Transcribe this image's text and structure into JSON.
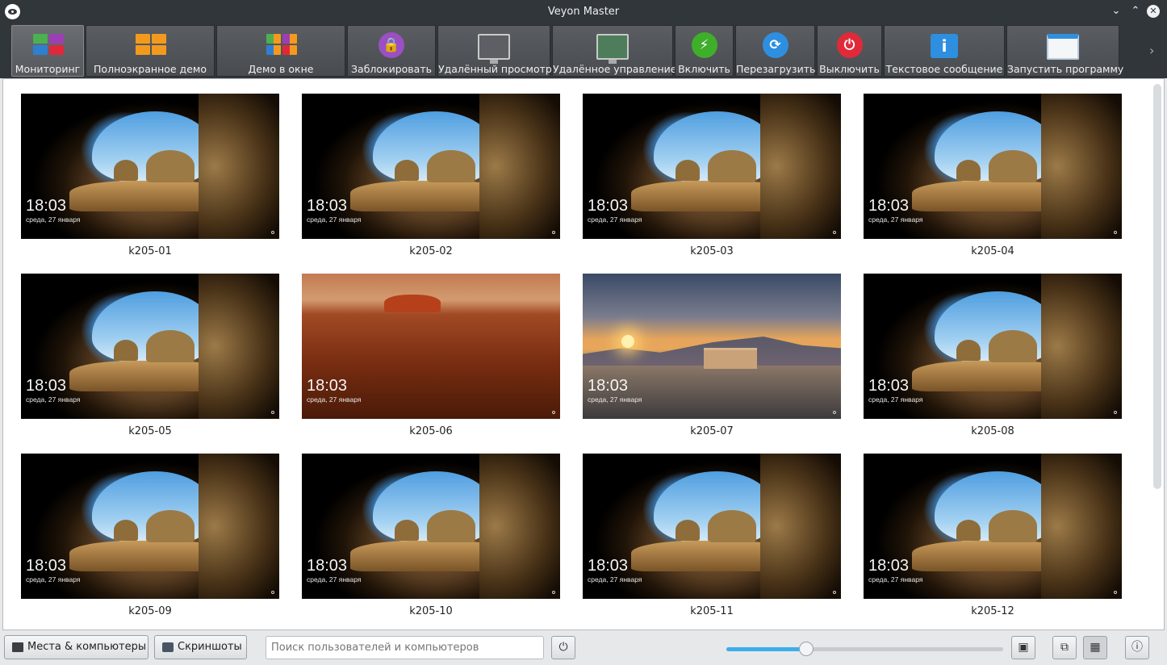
{
  "window": {
    "title": "Veyon Master"
  },
  "toolbar": {
    "buttons": [
      {
        "label": "Мониторинг",
        "icon": "monitoring-grid-icon",
        "active": true
      },
      {
        "label": "Полноэкранное демо",
        "icon": "fullscreen-demo-icon"
      },
      {
        "label": "Демо в окне",
        "icon": "window-demo-icon"
      },
      {
        "label": "Заблокировать",
        "icon": "lock-icon"
      },
      {
        "label": "Удалённый просмотр",
        "icon": "remote-view-icon"
      },
      {
        "label": "Удалённое управление",
        "icon": "remote-control-icon"
      },
      {
        "label": "Включить",
        "icon": "power-on-icon"
      },
      {
        "label": "Перезагрузить",
        "icon": "reboot-icon"
      },
      {
        "label": "Выключить",
        "icon": "power-off-icon"
      },
      {
        "label": "Текстовое сообщение",
        "icon": "text-message-icon"
      },
      {
        "label": "Запустить программу",
        "icon": "run-program-icon"
      }
    ]
  },
  "computers": [
    {
      "name": "k205-01",
      "time": "18:03",
      "date": "среда, 27 января",
      "wallpaper": "cave"
    },
    {
      "name": "k205-02",
      "time": "18:03",
      "date": "среда, 27 января",
      "wallpaper": "cave"
    },
    {
      "name": "k205-03",
      "time": "18:03",
      "date": "среда, 27 января",
      "wallpaper": "cave"
    },
    {
      "name": "k205-04",
      "time": "18:03",
      "date": "среда, 27 января",
      "wallpaper": "cave"
    },
    {
      "name": "k205-05",
      "time": "18:03",
      "date": "среда, 27 января",
      "wallpaper": "cave"
    },
    {
      "name": "k205-06",
      "time": "18:03",
      "date": "среда, 27 января",
      "wallpaper": "uluru"
    },
    {
      "name": "k205-07",
      "time": "18:03",
      "date": "среда, 27 января",
      "wallpaper": "palace"
    },
    {
      "name": "k205-08",
      "time": "18:03",
      "date": "среда, 27 января",
      "wallpaper": "cave"
    },
    {
      "name": "k205-09",
      "time": "18:03",
      "date": "среда, 27 января",
      "wallpaper": "cave"
    },
    {
      "name": "k205-10",
      "time": "18:03",
      "date": "среда, 27 января",
      "wallpaper": "cave"
    },
    {
      "name": "k205-11",
      "time": "18:03",
      "date": "среда, 27 января",
      "wallpaper": "cave"
    },
    {
      "name": "k205-12",
      "time": "18:03",
      "date": "среда, 27 января",
      "wallpaper": "cave"
    }
  ],
  "statusbar": {
    "locations_button": "Места & компьютеры",
    "screenshots_button": "Скриншоты",
    "search_placeholder": "Поиск пользователей и компьютеров",
    "zoom_fraction": 0.29
  },
  "colors": {
    "accent": "#3daee9",
    "titlebar": "#31363b"
  }
}
